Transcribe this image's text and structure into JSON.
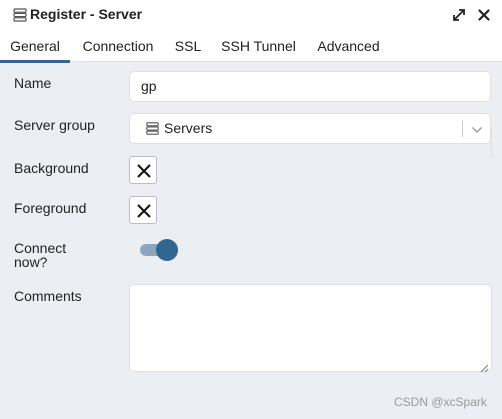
{
  "window": {
    "title": "Register - Server",
    "icon": "server-icon"
  },
  "controls": {
    "expand_icon": "expand-icon",
    "close_icon": "close-icon"
  },
  "tabs": [
    {
      "label": "General",
      "active": true
    },
    {
      "label": "Connection",
      "active": false
    },
    {
      "label": "SSL",
      "active": false
    },
    {
      "label": "SSH Tunnel",
      "active": false
    },
    {
      "label": "Advanced",
      "active": false
    }
  ],
  "form": {
    "name": {
      "label": "Name",
      "value": "gp"
    },
    "server_group": {
      "label": "Server group",
      "value": "Servers",
      "icon": "server-group-icon"
    },
    "background": {
      "label": "Background",
      "icon": "clear-x-icon"
    },
    "foreground": {
      "label": "Foreground",
      "icon": "clear-x-icon"
    },
    "connect_now": {
      "label_line1": "Connect",
      "label_line2": "now?",
      "enabled": true
    },
    "comments": {
      "label": "Comments",
      "value": ""
    }
  },
  "watermark": "CSDN @xcSpark",
  "colors": {
    "accent": "#326690",
    "toggle_track": "#8ca6be",
    "panel_bg": "#ebeef3"
  }
}
